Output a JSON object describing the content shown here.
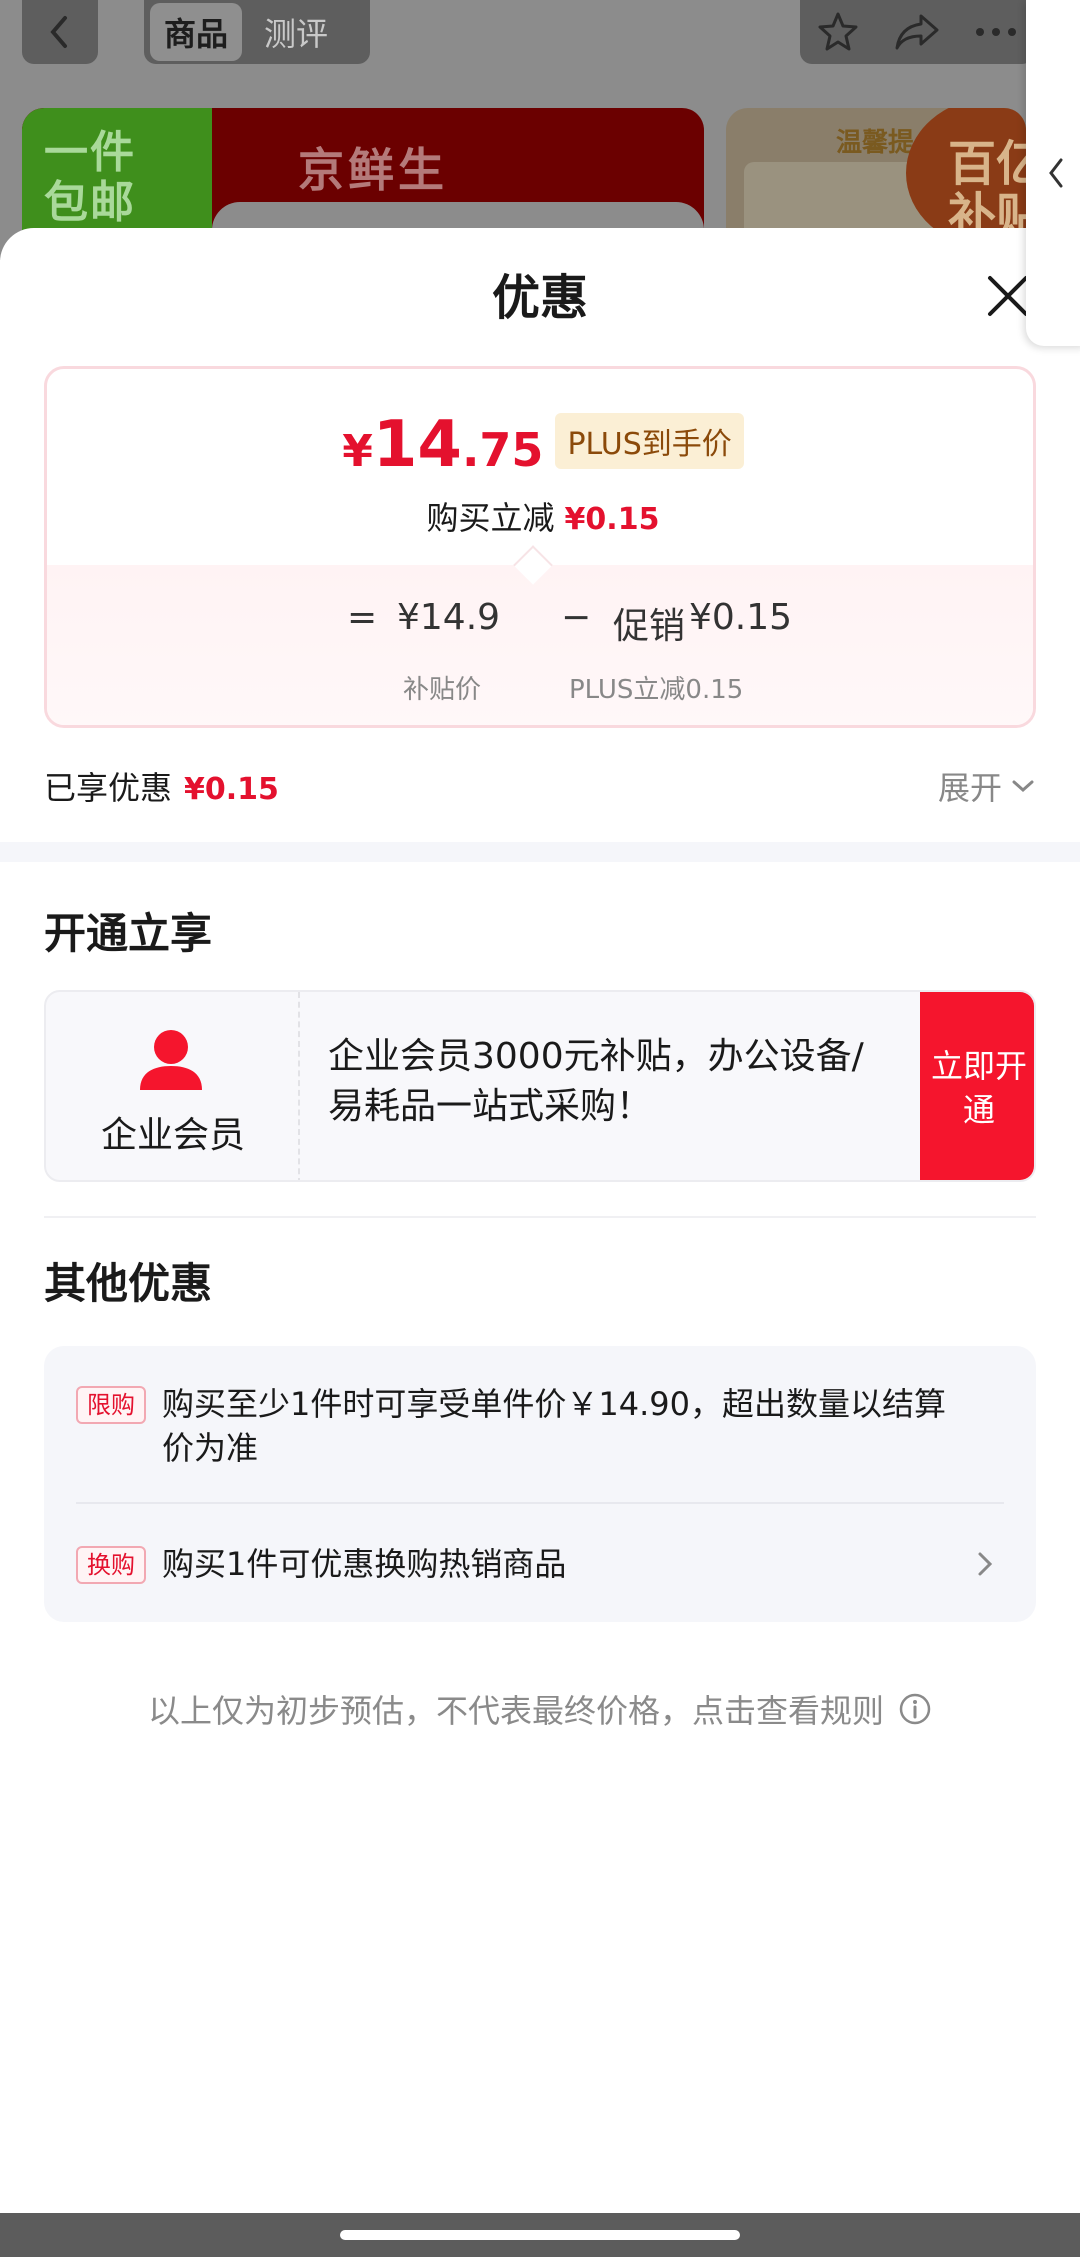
{
  "background": {
    "tabs": [
      "商品",
      "测评"
    ],
    "banner_left_badge": [
      "一件",
      "包邮"
    ],
    "banner_left_title": "京鲜生",
    "banner_right_title": "温馨提",
    "banner_right_badge": [
      "百亿",
      "补贴"
    ]
  },
  "sheet": {
    "title": "优惠",
    "price": {
      "symbol": "¥",
      "integer": "14",
      "decimal": ".75",
      "plus_tag": "PLUS到手价",
      "instant_discount_label": "购买立减",
      "instant_discount_value": "¥0.15"
    },
    "formula": {
      "equals": "=",
      "base_price": "¥14.9",
      "minus": "−",
      "promo_label": "促销",
      "promo_value": "¥0.15",
      "base_caption": "补贴价",
      "promo_caption": "PLUS立减0.15"
    },
    "enjoyed": {
      "label": "已享优惠",
      "value": "¥0.15",
      "expand": "展开"
    },
    "membership": {
      "section_title": "开通立享",
      "name": "企业会员",
      "description": "企业会员3000元补贴，办公设备/易耗品一站式采购！",
      "button": "立即开通"
    },
    "other": {
      "section_title": "其他优惠",
      "items": [
        {
          "tag": "限购",
          "text": "购买至少1件时可享受单件价￥14.90，超出数量以结算价为准"
        },
        {
          "tag": "换购",
          "text": "购买1件可优惠换购热销商品"
        }
      ]
    },
    "footer_note": "以上仅为初步预估，不代表最终价格，点击查看规则"
  },
  "colors": {
    "accent_red": "#e4112e",
    "plus_tag_bg": "#fbefd5",
    "member_button": "#f5152d"
  }
}
